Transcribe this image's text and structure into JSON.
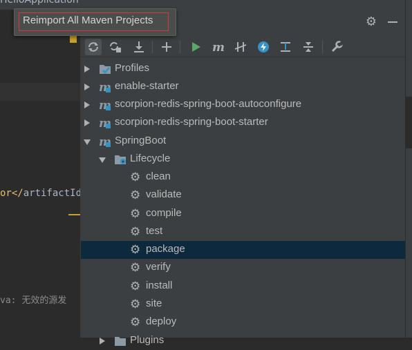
{
  "editor": {
    "tab_title": "HelloApplication",
    "code_line_tag": "or</",
    "code_line_text": "artifactId",
    "console_prefix": "va: ",
    "console_text": "无效的源发"
  },
  "tooltip": {
    "text": "Reimport All Maven Projects"
  },
  "toolbar": {
    "buttons": [
      {
        "icon": "reimport-icon",
        "tooltip": "Reimport All Maven Projects"
      },
      {
        "icon": "generate-sources-icon"
      },
      {
        "icon": "download-icon"
      },
      {
        "icon": "add-icon"
      },
      {
        "icon": "run-icon"
      },
      {
        "icon": "maven-goal-icon"
      },
      {
        "icon": "toggle-offline-icon"
      },
      {
        "icon": "skip-tests-icon"
      },
      {
        "icon": "show-dependencies-icon"
      },
      {
        "icon": "collapse-all-icon"
      },
      {
        "icon": "settings-wrench-icon"
      }
    ]
  },
  "tree": {
    "items": [
      {
        "label": "Profiles",
        "level": 0,
        "expanded": false,
        "icon": "profiles-icon"
      },
      {
        "label": "enable-starter",
        "level": 0,
        "expanded": false,
        "icon": "maven-module-icon"
      },
      {
        "label": "scorpion-redis-spring-boot-autoconfigure",
        "level": 0,
        "expanded": false,
        "icon": "maven-module-icon"
      },
      {
        "label": "scorpion-redis-spring-boot-starter",
        "level": 0,
        "expanded": false,
        "icon": "maven-module-icon"
      },
      {
        "label": "SpringBoot",
        "level": 0,
        "expanded": true,
        "icon": "maven-module-icon"
      },
      {
        "label": "Lifecycle",
        "level": 1,
        "expanded": true,
        "icon": "lifecycle-folder-icon"
      },
      {
        "label": "clean",
        "level": 2,
        "icon": "gear-icon"
      },
      {
        "label": "validate",
        "level": 2,
        "icon": "gear-icon"
      },
      {
        "label": "compile",
        "level": 2,
        "icon": "gear-icon"
      },
      {
        "label": "test",
        "level": 2,
        "icon": "gear-icon"
      },
      {
        "label": "package",
        "level": 2,
        "icon": "gear-icon",
        "selected": true
      },
      {
        "label": "verify",
        "level": 2,
        "icon": "gear-icon"
      },
      {
        "label": "install",
        "level": 2,
        "icon": "gear-icon"
      },
      {
        "label": "site",
        "level": 2,
        "icon": "gear-icon"
      },
      {
        "label": "deploy",
        "level": 2,
        "icon": "gear-icon"
      },
      {
        "label": "Plugins",
        "level": 1,
        "expanded": false,
        "icon": "plugins-folder-icon"
      }
    ]
  },
  "colors": {
    "panel_bg": "#3c3f41",
    "editor_bg": "#2b2b2b",
    "selection_bg": "#0d293e",
    "maven_blue": "#3592c4",
    "run_green": "#59a869",
    "tooltip_border": "#d83a3a"
  }
}
